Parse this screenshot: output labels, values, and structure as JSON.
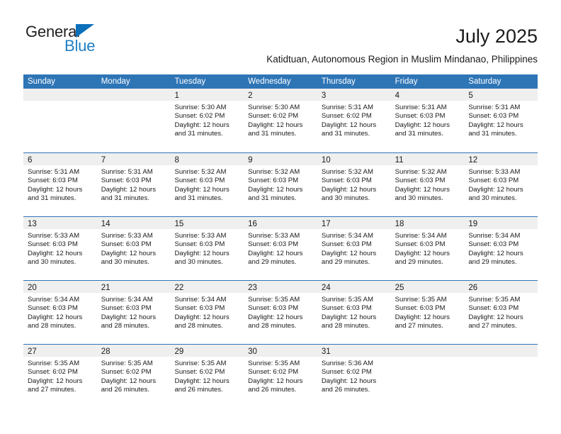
{
  "brand": {
    "name_part1": "General",
    "name_part2": "Blue",
    "triangle_color": "#0b6fba",
    "blue_text_color": "#1f7ec4"
  },
  "header": {
    "month_title": "July 2025",
    "location_subtitle": "Katidtuan, Autonomous Region in Muslim Mindanao, Philippines"
  },
  "theme": {
    "header_blue": "#2e75b6",
    "day_band_gray": "#efefef",
    "text_color": "#1a1a1a"
  },
  "weekdays": [
    "Sunday",
    "Monday",
    "Tuesday",
    "Wednesday",
    "Thursday",
    "Friday",
    "Saturday"
  ],
  "weeks": [
    [
      {
        "day": "",
        "sunrise": "",
        "sunset": "",
        "daylight1": "",
        "daylight2": ""
      },
      {
        "day": "",
        "sunrise": "",
        "sunset": "",
        "daylight1": "",
        "daylight2": ""
      },
      {
        "day": "1",
        "sunrise": "Sunrise: 5:30 AM",
        "sunset": "Sunset: 6:02 PM",
        "daylight1": "Daylight: 12 hours",
        "daylight2": "and 31 minutes."
      },
      {
        "day": "2",
        "sunrise": "Sunrise: 5:30 AM",
        "sunset": "Sunset: 6:02 PM",
        "daylight1": "Daylight: 12 hours",
        "daylight2": "and 31 minutes."
      },
      {
        "day": "3",
        "sunrise": "Sunrise: 5:31 AM",
        "sunset": "Sunset: 6:02 PM",
        "daylight1": "Daylight: 12 hours",
        "daylight2": "and 31 minutes."
      },
      {
        "day": "4",
        "sunrise": "Sunrise: 5:31 AM",
        "sunset": "Sunset: 6:03 PM",
        "daylight1": "Daylight: 12 hours",
        "daylight2": "and 31 minutes."
      },
      {
        "day": "5",
        "sunrise": "Sunrise: 5:31 AM",
        "sunset": "Sunset: 6:03 PM",
        "daylight1": "Daylight: 12 hours",
        "daylight2": "and 31 minutes."
      }
    ],
    [
      {
        "day": "6",
        "sunrise": "Sunrise: 5:31 AM",
        "sunset": "Sunset: 6:03 PM",
        "daylight1": "Daylight: 12 hours",
        "daylight2": "and 31 minutes."
      },
      {
        "day": "7",
        "sunrise": "Sunrise: 5:31 AM",
        "sunset": "Sunset: 6:03 PM",
        "daylight1": "Daylight: 12 hours",
        "daylight2": "and 31 minutes."
      },
      {
        "day": "8",
        "sunrise": "Sunrise: 5:32 AM",
        "sunset": "Sunset: 6:03 PM",
        "daylight1": "Daylight: 12 hours",
        "daylight2": "and 31 minutes."
      },
      {
        "day": "9",
        "sunrise": "Sunrise: 5:32 AM",
        "sunset": "Sunset: 6:03 PM",
        "daylight1": "Daylight: 12 hours",
        "daylight2": "and 31 minutes."
      },
      {
        "day": "10",
        "sunrise": "Sunrise: 5:32 AM",
        "sunset": "Sunset: 6:03 PM",
        "daylight1": "Daylight: 12 hours",
        "daylight2": "and 30 minutes."
      },
      {
        "day": "11",
        "sunrise": "Sunrise: 5:32 AM",
        "sunset": "Sunset: 6:03 PM",
        "daylight1": "Daylight: 12 hours",
        "daylight2": "and 30 minutes."
      },
      {
        "day": "12",
        "sunrise": "Sunrise: 5:33 AM",
        "sunset": "Sunset: 6:03 PM",
        "daylight1": "Daylight: 12 hours",
        "daylight2": "and 30 minutes."
      }
    ],
    [
      {
        "day": "13",
        "sunrise": "Sunrise: 5:33 AM",
        "sunset": "Sunset: 6:03 PM",
        "daylight1": "Daylight: 12 hours",
        "daylight2": "and 30 minutes."
      },
      {
        "day": "14",
        "sunrise": "Sunrise: 5:33 AM",
        "sunset": "Sunset: 6:03 PM",
        "daylight1": "Daylight: 12 hours",
        "daylight2": "and 30 minutes."
      },
      {
        "day": "15",
        "sunrise": "Sunrise: 5:33 AM",
        "sunset": "Sunset: 6:03 PM",
        "daylight1": "Daylight: 12 hours",
        "daylight2": "and 30 minutes."
      },
      {
        "day": "16",
        "sunrise": "Sunrise: 5:33 AM",
        "sunset": "Sunset: 6:03 PM",
        "daylight1": "Daylight: 12 hours",
        "daylight2": "and 29 minutes."
      },
      {
        "day": "17",
        "sunrise": "Sunrise: 5:34 AM",
        "sunset": "Sunset: 6:03 PM",
        "daylight1": "Daylight: 12 hours",
        "daylight2": "and 29 minutes."
      },
      {
        "day": "18",
        "sunrise": "Sunrise: 5:34 AM",
        "sunset": "Sunset: 6:03 PM",
        "daylight1": "Daylight: 12 hours",
        "daylight2": "and 29 minutes."
      },
      {
        "day": "19",
        "sunrise": "Sunrise: 5:34 AM",
        "sunset": "Sunset: 6:03 PM",
        "daylight1": "Daylight: 12 hours",
        "daylight2": "and 29 minutes."
      }
    ],
    [
      {
        "day": "20",
        "sunrise": "Sunrise: 5:34 AM",
        "sunset": "Sunset: 6:03 PM",
        "daylight1": "Daylight: 12 hours",
        "daylight2": "and 28 minutes."
      },
      {
        "day": "21",
        "sunrise": "Sunrise: 5:34 AM",
        "sunset": "Sunset: 6:03 PM",
        "daylight1": "Daylight: 12 hours",
        "daylight2": "and 28 minutes."
      },
      {
        "day": "22",
        "sunrise": "Sunrise: 5:34 AM",
        "sunset": "Sunset: 6:03 PM",
        "daylight1": "Daylight: 12 hours",
        "daylight2": "and 28 minutes."
      },
      {
        "day": "23",
        "sunrise": "Sunrise: 5:35 AM",
        "sunset": "Sunset: 6:03 PM",
        "daylight1": "Daylight: 12 hours",
        "daylight2": "and 28 minutes."
      },
      {
        "day": "24",
        "sunrise": "Sunrise: 5:35 AM",
        "sunset": "Sunset: 6:03 PM",
        "daylight1": "Daylight: 12 hours",
        "daylight2": "and 28 minutes."
      },
      {
        "day": "25",
        "sunrise": "Sunrise: 5:35 AM",
        "sunset": "Sunset: 6:03 PM",
        "daylight1": "Daylight: 12 hours",
        "daylight2": "and 27 minutes."
      },
      {
        "day": "26",
        "sunrise": "Sunrise: 5:35 AM",
        "sunset": "Sunset: 6:03 PM",
        "daylight1": "Daylight: 12 hours",
        "daylight2": "and 27 minutes."
      }
    ],
    [
      {
        "day": "27",
        "sunrise": "Sunrise: 5:35 AM",
        "sunset": "Sunset: 6:02 PM",
        "daylight1": "Daylight: 12 hours",
        "daylight2": "and 27 minutes."
      },
      {
        "day": "28",
        "sunrise": "Sunrise: 5:35 AM",
        "sunset": "Sunset: 6:02 PM",
        "daylight1": "Daylight: 12 hours",
        "daylight2": "and 26 minutes."
      },
      {
        "day": "29",
        "sunrise": "Sunrise: 5:35 AM",
        "sunset": "Sunset: 6:02 PM",
        "daylight1": "Daylight: 12 hours",
        "daylight2": "and 26 minutes."
      },
      {
        "day": "30",
        "sunrise": "Sunrise: 5:35 AM",
        "sunset": "Sunset: 6:02 PM",
        "daylight1": "Daylight: 12 hours",
        "daylight2": "and 26 minutes."
      },
      {
        "day": "31",
        "sunrise": "Sunrise: 5:36 AM",
        "sunset": "Sunset: 6:02 PM",
        "daylight1": "Daylight: 12 hours",
        "daylight2": "and 26 minutes."
      },
      {
        "day": "",
        "sunrise": "",
        "sunset": "",
        "daylight1": "",
        "daylight2": ""
      },
      {
        "day": "",
        "sunrise": "",
        "sunset": "",
        "daylight1": "",
        "daylight2": ""
      }
    ]
  ]
}
